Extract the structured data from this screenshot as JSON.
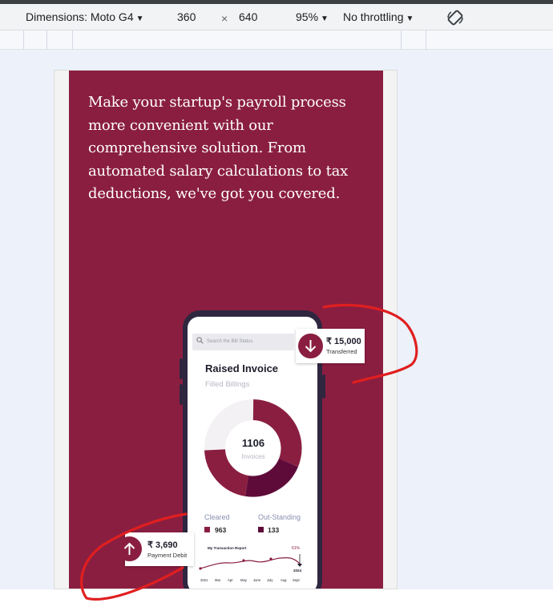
{
  "toolbar": {
    "dimensions_label": "Dimensions: Moto G4",
    "width_value": "360",
    "times_sign": "×",
    "height_value": "640",
    "zoom_label": "95%",
    "throttle_label": "No throttling"
  },
  "hero": {
    "text": "Make your startup's payroll process more convenient with our comprehensive solution. From automated salary calculations to tax deductions, we've got you covered."
  },
  "phone": {
    "search_placeholder": "Search the Bill Status",
    "title": "Raised Invoice",
    "subtitle": "Filled Billings",
    "donut_value": "1106",
    "donut_label": "Invoices",
    "cleared_label": "Cleared",
    "cleared_count": "963",
    "outstanding_label": "Out-Standing",
    "outstanding_count": "133",
    "report_title": "My Transaction Report",
    "report_percent": "61%",
    "report_year_badge": "2024",
    "report_x_labels": [
      "2021",
      "Mar",
      "Apr",
      "May",
      "June",
      "July",
      "Aug",
      "Sept"
    ]
  },
  "cards": {
    "transferred_amount": "₹ 15,000",
    "transferred_label": "Transferred",
    "debit_amount": "₹ 3,690",
    "debit_label": "Payment Debit"
  },
  "colors": {
    "brand": "#8a1e41",
    "brand_dark": "#5e0b3a",
    "annotation": "#e01f1f"
  }
}
